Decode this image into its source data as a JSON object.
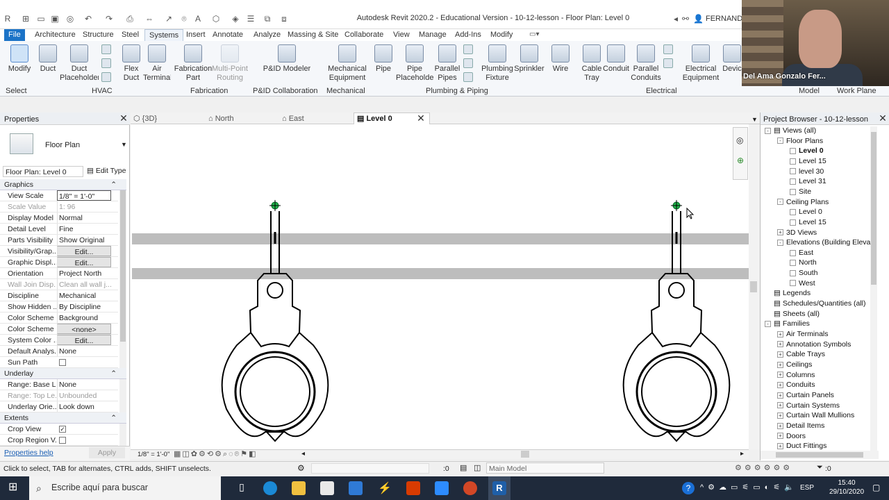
{
  "app": {
    "title": "Autodesk Revit 2020.2 - Educational Version - 10-12-lesson - Floor Plan: Level 0",
    "user": "FERNANDO"
  },
  "ribbon_tabs": [
    "File",
    "Architecture",
    "Structure",
    "Steel",
    "Systems",
    "Insert",
    "Annotate",
    "Analyze",
    "Massing & Site",
    "Collaborate",
    "View",
    "Manage",
    "Add-Ins",
    "Modify"
  ],
  "active_tab": "Systems",
  "ribbon_buttons": [
    {
      "id": "modify",
      "label": "Modify"
    },
    {
      "id": "duct",
      "label": "Duct"
    },
    {
      "id": "duct-placeholder",
      "label": "Duct\nPlaceholder"
    },
    {
      "id": "flex-duct",
      "label": "Flex\nDuct"
    },
    {
      "id": "air-terminal",
      "label": "Air\nTerminal"
    },
    {
      "id": "fabrication-part",
      "label": "Fabrication\nPart"
    },
    {
      "id": "multi-point-routing",
      "label": "Multi-Point\nRouting",
      "disabled": true
    },
    {
      "id": "pid-modeler",
      "label": "P&ID Modeler"
    },
    {
      "id": "mechanical-equipment",
      "label": "Mechanical\nEquipment"
    },
    {
      "id": "pipe",
      "label": "Pipe"
    },
    {
      "id": "pipe-placeholder",
      "label": "Pipe\nPlaceholder"
    },
    {
      "id": "parallel-pipes",
      "label": "Parallel\nPipes"
    },
    {
      "id": "plumbing-fixture",
      "label": "Plumbing\nFixture"
    },
    {
      "id": "sprinkler",
      "label": "Sprinkler"
    },
    {
      "id": "wire",
      "label": "Wire"
    },
    {
      "id": "cable-tray",
      "label": "Cable\nTray"
    },
    {
      "id": "conduit",
      "label": "Conduit"
    },
    {
      "id": "parallel-conduits",
      "label": "Parallel\nConduits"
    },
    {
      "id": "electrical-equipment",
      "label": "Electrical\nEquipment"
    },
    {
      "id": "device",
      "label": "Devic"
    }
  ],
  "ribbon_panels": [
    "Select",
    "HVAC",
    "Fabrication",
    "P&ID Collaboration",
    "Mechanical",
    "Plumbing & Piping",
    "Electrical",
    "Model",
    "Work Plane"
  ],
  "video_overlay": {
    "name": "Del Ama Gonzalo Fer..."
  },
  "properties": {
    "title": "Properties",
    "type_name": "Floor Plan",
    "instance_selector": "Floor Plan: Level 0",
    "edit_type": "Edit Type",
    "sections": [
      {
        "name": "Graphics",
        "rows": [
          {
            "k": "View Scale",
            "v": "1/8\" = 1'-0\"",
            "style": "field"
          },
          {
            "k": "Scale Value",
            "v": "1:  96",
            "grey": true
          },
          {
            "k": "Display Model",
            "v": "Normal"
          },
          {
            "k": "Detail Level",
            "v": "Fine"
          },
          {
            "k": "Parts Visibility",
            "v": "Show Original"
          },
          {
            "k": "Visibility/Grap...",
            "v": "Edit...",
            "style": "btn"
          },
          {
            "k": "Graphic Displ...",
            "v": "Edit...",
            "style": "btn"
          },
          {
            "k": "Orientation",
            "v": "Project North"
          },
          {
            "k": "Wall Join Disp...",
            "v": "Clean all wall j...",
            "grey": true
          },
          {
            "k": "Discipline",
            "v": "Mechanical"
          },
          {
            "k": "Show Hidden ...",
            "v": "By Discipline"
          },
          {
            "k": "Color Scheme ...",
            "v": "Background"
          },
          {
            "k": "Color Scheme",
            "v": "<none>",
            "style": "btn"
          },
          {
            "k": "System Color ...",
            "v": "Edit...",
            "style": "btn"
          },
          {
            "k": "Default Analys...",
            "v": "None"
          },
          {
            "k": "Sun Path",
            "v": "",
            "style": "check",
            "checked": false
          }
        ]
      },
      {
        "name": "Underlay",
        "rows": [
          {
            "k": "Range: Base L...",
            "v": "None"
          },
          {
            "k": "Range: Top Le...",
            "v": "Unbounded",
            "grey": true
          },
          {
            "k": "Underlay Orie...",
            "v": "Look down"
          }
        ]
      },
      {
        "name": "Extents",
        "rows": [
          {
            "k": "Crop View",
            "v": "",
            "style": "check",
            "checked": true
          },
          {
            "k": "Crop Region V...",
            "v": "",
            "style": "check",
            "checked": false
          }
        ]
      }
    ],
    "help_link": "Properties help",
    "apply": "Apply"
  },
  "view_tabs": [
    {
      "label": "{3D}"
    },
    {
      "label": "North"
    },
    {
      "label": "East"
    },
    {
      "label": "Level 0",
      "active": true
    }
  ],
  "view_bar": {
    "scale": "1/8\" = 1'-0\""
  },
  "project_browser": {
    "title": "Project Browser - 10-12-lesson",
    "items": [
      {
        "label": "Views (all)",
        "level": 0,
        "toggle": "-"
      },
      {
        "label": "Floor Plans",
        "level": 1,
        "toggle": "-"
      },
      {
        "label": "Level 0",
        "level": 2,
        "bold": true
      },
      {
        "label": "Level 15",
        "level": 2
      },
      {
        "label": "level 30",
        "level": 2
      },
      {
        "label": "Level 31",
        "level": 2
      },
      {
        "label": "Site",
        "level": 2
      },
      {
        "label": "Ceiling Plans",
        "level": 1,
        "toggle": "-"
      },
      {
        "label": "Level 0",
        "level": 2
      },
      {
        "label": "Level 15",
        "level": 2
      },
      {
        "label": "3D Views",
        "level": 1,
        "toggle": "+"
      },
      {
        "label": "Elevations (Building Eleva",
        "level": 1,
        "toggle": "-"
      },
      {
        "label": "East",
        "level": 2
      },
      {
        "label": "North",
        "level": 2
      },
      {
        "label": "South",
        "level": 2
      },
      {
        "label": "West",
        "level": 2
      },
      {
        "label": "Legends",
        "level": 0,
        "toggle": ""
      },
      {
        "label": "Schedules/Quantities (all)",
        "level": 0,
        "toggle": ""
      },
      {
        "label": "Sheets (all)",
        "level": 0,
        "toggle": ""
      },
      {
        "label": "Families",
        "level": 0,
        "toggle": "-"
      },
      {
        "label": "Air Terminals",
        "level": 1,
        "toggle": "+"
      },
      {
        "label": "Annotation Symbols",
        "level": 1,
        "toggle": "+"
      },
      {
        "label": "Cable Trays",
        "level": 1,
        "toggle": "+"
      },
      {
        "label": "Ceilings",
        "level": 1,
        "toggle": "+"
      },
      {
        "label": "Columns",
        "level": 1,
        "toggle": "+"
      },
      {
        "label": "Conduits",
        "level": 1,
        "toggle": "+"
      },
      {
        "label": "Curtain Panels",
        "level": 1,
        "toggle": "+"
      },
      {
        "label": "Curtain Systems",
        "level": 1,
        "toggle": "+"
      },
      {
        "label": "Curtain Wall Mullions",
        "level": 1,
        "toggle": "+"
      },
      {
        "label": "Detail Items",
        "level": 1,
        "toggle": "+"
      },
      {
        "label": "Doors",
        "level": 1,
        "toggle": "+"
      },
      {
        "label": "Duct Fittings",
        "level": 1,
        "toggle": "+"
      }
    ]
  },
  "status": {
    "hint": "Click to select, TAB for alternates, CTRL adds, SHIFT unselects.",
    "zero": ":0",
    "model": "Main Model",
    "filter_count": ":0"
  },
  "taskbar": {
    "search_placeholder": "Escribe aquí para buscar",
    "lang": "ESP",
    "time": "15:40",
    "date": "29/10/2020"
  }
}
